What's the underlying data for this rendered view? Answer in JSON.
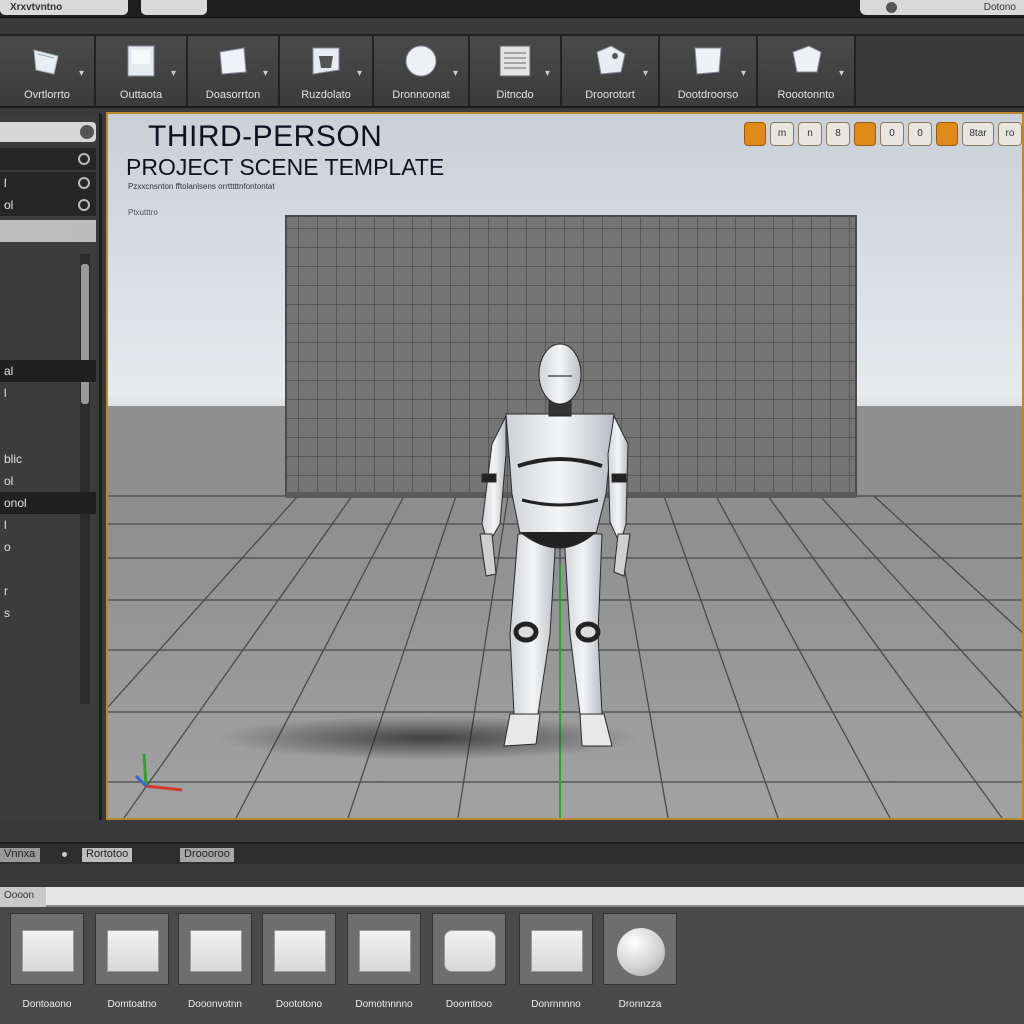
{
  "window": {
    "tab_left": "Xrxvtvntno",
    "tab_mid": "",
    "tab_right": "Dotono"
  },
  "toolbar": {
    "items": [
      {
        "label": "Ovrtlorrto",
        "icon": "select-icon"
      },
      {
        "label": "Outtaota",
        "icon": "content-icon"
      },
      {
        "label": "Doasorrton",
        "icon": "marketplace-icon"
      },
      {
        "label": "Ruzdolato",
        "icon": "blueprint-icon"
      },
      {
        "label": "Dronnoonat",
        "icon": "cinematics-icon"
      },
      {
        "label": "Ditncdo",
        "icon": "build-icon"
      },
      {
        "label": "Droorotort",
        "icon": "play-icon"
      },
      {
        "label": "Dootdroorso",
        "icon": "launch-icon"
      },
      {
        "label": "Roootonnto",
        "icon": "settings-icon"
      }
    ]
  },
  "outliner": {
    "rows": [
      {
        "label": "",
        "style": "dark"
      },
      {
        "label": "l",
        "style": "dark"
      },
      {
        "label": "ol",
        "style": "dark"
      },
      {
        "label": "",
        "style": "light"
      }
    ],
    "items": [
      "al",
      "l",
      "",
      "",
      "blic",
      "ol",
      "onol",
      "l",
      "o",
      "",
      "r",
      "s"
    ]
  },
  "viewport": {
    "title": "THIRD-PERSON",
    "subtitle": "PROJECT SCENE TEMPLATE",
    "small_text": "Pzxxcnsnton fftolanlsens orrtttttnfontontat",
    "small_text2": "Ptxutttro",
    "buttons": [
      {
        "label": "",
        "kind": "orange"
      },
      {
        "label": "m",
        "kind": "s"
      },
      {
        "label": "n",
        "kind": "s"
      },
      {
        "label": "8",
        "kind": "s"
      },
      {
        "label": "",
        "kind": "orange"
      },
      {
        "label": "0",
        "kind": "s"
      },
      {
        "label": "0",
        "kind": "s"
      },
      {
        "label": "",
        "kind": "orange"
      },
      {
        "label": "8tar",
        "kind": "w"
      },
      {
        "label": "ro",
        "kind": "s"
      }
    ]
  },
  "content_browser": {
    "tabs": [
      "Vnnxa",
      "Rortotoo",
      "Droooroo"
    ],
    "filter_label": "Oooon",
    "assets": [
      {
        "label": "Dontoaono",
        "shape": "plane"
      },
      {
        "label": "Domtoatno",
        "shape": "plane"
      },
      {
        "label": "Dooonvotnn",
        "shape": "plane"
      },
      {
        "label": "Doototono",
        "shape": "mesh"
      },
      {
        "label": "Domotnnnno",
        "shape": "plane"
      },
      {
        "label": "Doomtooo",
        "shape": "cube"
      },
      {
        "label": "Donrnnnno",
        "shape": "plane"
      },
      {
        "label": "Dronnzza",
        "shape": "sphere"
      }
    ]
  },
  "colors": {
    "viewport_border": "#b8892e",
    "accent_orange": "#e08a1a"
  }
}
